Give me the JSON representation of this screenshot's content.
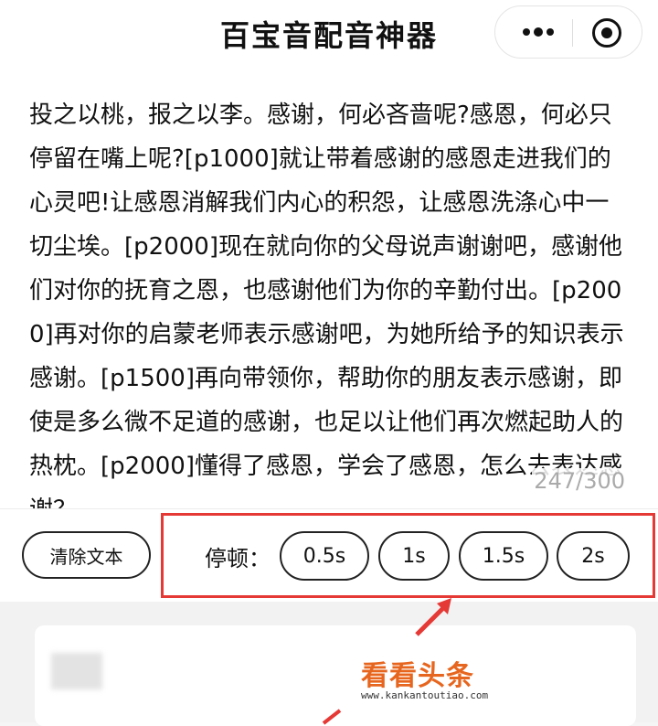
{
  "header": {
    "title": "百宝音配音神器"
  },
  "editor": {
    "text": "投之以桃，报之以李。感谢，何必吝啬呢?感恩，何必只停留在嘴上呢?[p1000]就让带着感谢的感恩走进我们的心灵吧!让感恩消解我们内心的积怨，让感恩洗涤心中一切尘埃。[p2000]现在就向你的父母说声谢谢吧，感谢他们对你的抚育之恩，也感谢他们为你的辛勤付出。[p2000]再对你的启蒙老师表示感谢吧，为她所给予的知识表示感谢。[p1500]再向带领你，帮助你的朋友表示感谢，即使是多么微不足道的感谢，也足以让他们再次燃起助人的热枕。[p2000]懂得了感恩，学会了感恩，怎么去表达感谢？",
    "counter": "247/300"
  },
  "toolbar": {
    "clear_label": "清除文本",
    "pause_label": "停顿：",
    "pause_options": [
      "0.5s",
      "1s",
      "1.5s",
      "2s"
    ]
  },
  "watermark": {
    "main": "看看头条",
    "url": "www.kankantoutiao.com"
  },
  "colors": {
    "highlight": "#e53935",
    "watermark": "#e7661f"
  }
}
